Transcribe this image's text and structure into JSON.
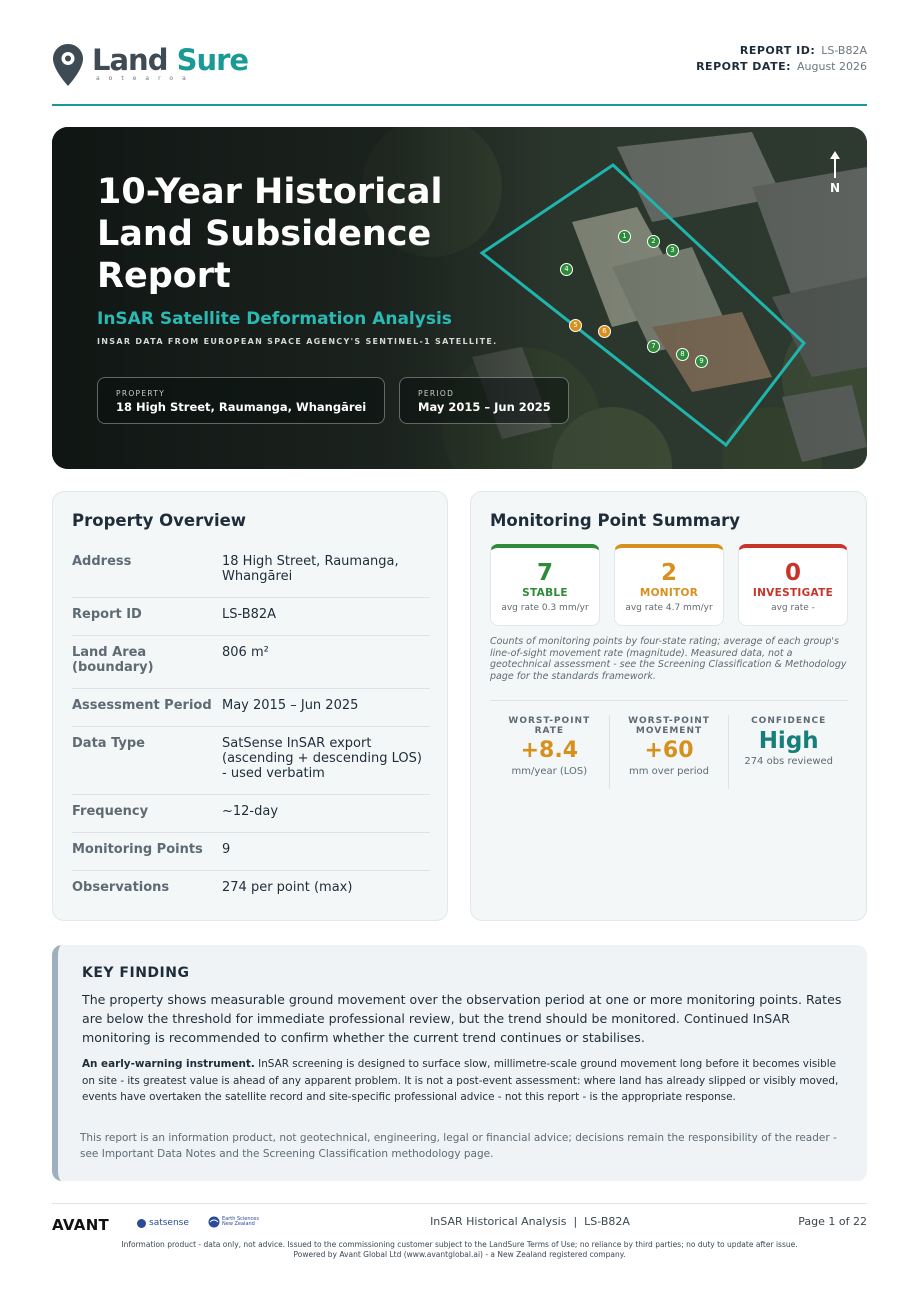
{
  "brand": {
    "name_part1": "Land",
    "name_part2": "Sure",
    "tagline": "aotearoa",
    "accent_color": "#1a9a96"
  },
  "report_meta": {
    "id_label": "REPORT ID:",
    "id_value": "LS-B82A",
    "date_label": "REPORT DATE:",
    "date_value": "August 2026"
  },
  "hero": {
    "title_line1": "10-Year Historical",
    "title_line2": "Land Subsidence",
    "title_line3": "Report",
    "subtitle": "InSAR Satellite Deformation Analysis",
    "source": "INSAR DATA FROM EUROPEAN SPACE AGENCY'S SENTINEL-1 SATELLITE.",
    "property_label": "PROPERTY",
    "property_value": "18 High Street, Raumanga, Whangārei",
    "period_label": "PERIOD",
    "period_value": "May 2015 – Jun 2025",
    "north_label": "N",
    "points": [
      {
        "label": "1",
        "status": "stable"
      },
      {
        "label": "2",
        "status": "stable"
      },
      {
        "label": "3",
        "status": "stable"
      },
      {
        "label": "4",
        "status": "stable"
      },
      {
        "label": "5",
        "status": "monitor"
      },
      {
        "label": "6",
        "status": "monitor"
      },
      {
        "label": "7",
        "status": "stable"
      },
      {
        "label": "8",
        "status": "stable"
      },
      {
        "label": "9",
        "status": "stable"
      }
    ]
  },
  "overview": {
    "title": "Property Overview",
    "rows": [
      {
        "label": "Address",
        "value": "18 High Street, Raumanga, Whangārei"
      },
      {
        "label": "Report ID",
        "value": "LS-B82A"
      },
      {
        "label": "Land Area (boundary)",
        "value": "806 m²"
      },
      {
        "label": "Assessment Period",
        "value": "May 2015 – Jun 2025"
      },
      {
        "label": "Data Type",
        "value": "SatSense InSAR export (ascending + descending LOS) - used verbatim"
      },
      {
        "label": "Frequency",
        "value": "~12-day"
      },
      {
        "label": "Monitoring Points",
        "value": "9"
      },
      {
        "label": "Observations",
        "value": "274 per point (max)"
      }
    ]
  },
  "summary": {
    "title": "Monitoring Point Summary",
    "tiles": [
      {
        "count": "7",
        "label": "STABLE",
        "avg": "avg rate 0.3 mm/yr",
        "color": "#2e8b3a"
      },
      {
        "count": "2",
        "label": "MONITOR",
        "avg": "avg rate 4.7 mm/yr",
        "color": "#d8901d"
      },
      {
        "count": "0",
        "label": "INVESTIGATE",
        "avg": "avg rate -",
        "color": "#c9342a"
      }
    ],
    "note": "Counts of monitoring points by four-state rating; average of each group's line-of-sight movement rate (magnitude). Measured data, not a geotechnical assessment - see the Screening Classification & Methodology page for the standards framework.",
    "metrics": [
      {
        "label_line1": "WORST-POINT",
        "label_line2": "RATE",
        "value": "+8.4",
        "unit": "mm/year (LOS)"
      },
      {
        "label_line1": "WORST-POINT",
        "label_line2": "MOVEMENT",
        "value": "+60",
        "unit": "mm over period"
      },
      {
        "label_line1": "CONFIDENCE",
        "label_line2": "",
        "value": "High",
        "unit": "274 obs reviewed"
      }
    ]
  },
  "key_finding": {
    "title": "KEY FINDING",
    "para1": "The property shows measurable ground movement over the observation period at one or more monitoring points. Rates are below the threshold for immediate professional review, but the trend should be monitored. Continued InSAR monitoring is recommended to confirm whether the current trend continues or stabilises.",
    "para2_bold": "An early-warning instrument.",
    "para2": " InSAR screening is designed to surface slow, millimetre-scale ground movement long before it becomes visible on site - its greatest value is ahead of any apparent problem. It is not a post-event assessment: where land has already slipped or visibly moved, events have overtaken the satellite record and site-specific professional advice - not this report - is the appropriate response.",
    "para3": "This report is an information product, not geotechnical, engineering, legal or financial advice; decisions remain the responsibility of the reader - see Important Data Notes and the Screening Classification methodology page."
  },
  "footer": {
    "partner1": "AVANT",
    "partner2": "satsense",
    "partner3_line1": "Earth Sciences",
    "partner3_line2": "New Zealand",
    "center": "InSAR Historical Analysis  |  LS-B82A",
    "page": "Page 1 of 22",
    "disclaimer_line1": "Information product - data only, not advice. Issued to the commissioning customer subject to the LandSure Terms of Use; no reliance by third parties; no duty to update after issue.",
    "disclaimer_line2": "Powered by Avant Global Ltd (www.avantglobal.ai) - a New Zealand registered company."
  }
}
